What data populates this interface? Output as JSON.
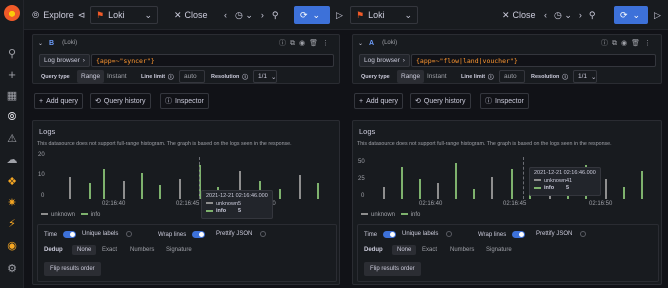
{
  "sidebar": {
    "icons": [
      "grafana-logo-icon",
      "search-icon",
      "plus-icon",
      "dashboards-icon",
      "explore-icon",
      "alerting-icon",
      "cloud-icon",
      "plugin-icon",
      "shield-icon",
      "plugin2-icon",
      "globe-icon",
      "gear-icon"
    ]
  },
  "topbar": {
    "title": "Explore",
    "left_datasource": "Loki",
    "right_datasource": "Loki",
    "close_label": "Close"
  },
  "left": {
    "query": {
      "letter": "B",
      "datasource": "(Loki)",
      "log_browser": "Log browser",
      "expr": "{app=~\"syncer\"}",
      "query_type_label": "Query type",
      "range": "Range",
      "instant": "Instant",
      "line_limit_label": "Line limit",
      "line_limit_value": "auto",
      "resolution_label": "Resolution",
      "resolution_value": "1/1"
    },
    "actions": {
      "add": "Add query",
      "history": "Query history",
      "inspector": "Inspector"
    },
    "logs": {
      "title": "Logs",
      "note": "This datasource does not support full-range histogram. The graph is based on the logs seen in the response.",
      "y_ticks": [
        "20",
        "10",
        "0"
      ],
      "x_ticks": [
        "02:16:40",
        "02:16:45",
        "02:16:50"
      ],
      "legend": [
        "unknown",
        "info"
      ],
      "tooltip": {
        "time": "2021-12-21 02:16:46.000",
        "rows": [
          {
            "name": "unknown",
            "value": "5"
          },
          {
            "name": "info",
            "value": "5"
          }
        ]
      },
      "controls": {
        "time": "Time",
        "unique": "Unique labels",
        "wrap": "Wrap lines",
        "prettify": "Prettify JSON",
        "dedup": "Dedup",
        "none": "None",
        "exact": "Exact",
        "numbers": "Numbers",
        "signature": "Signature",
        "flip": "Flip results order"
      }
    }
  },
  "right": {
    "query": {
      "letter": "A",
      "datasource": "(Loki)",
      "log_browser": "Log browser",
      "expr": "{app=~\"flow|land|voucher\"}",
      "query_type_label": "Query type",
      "range": "Range",
      "instant": "Instant",
      "line_limit_label": "Line limit",
      "line_limit_value": "auto",
      "resolution_label": "Resolution",
      "resolution_value": "1/1"
    },
    "actions": {
      "add": "Add query",
      "history": "Query history",
      "inspector": "Inspector"
    },
    "logs": {
      "title": "Logs",
      "note": "This datasource does not support full-range histogram. The graph is based on the logs seen in the response.",
      "y_ticks": [
        "50",
        "25",
        "0"
      ],
      "x_ticks": [
        "02:16:40",
        "02:16:45",
        "02:16:50"
      ],
      "legend": [
        "unknown",
        "info"
      ],
      "tooltip": {
        "time": "2021-12-21 02:16:46.000",
        "rows": [
          {
            "name": "unknown",
            "value": "41"
          },
          {
            "name": "info",
            "value": "5"
          }
        ]
      },
      "controls": {
        "time": "Time",
        "unique": "Unique labels",
        "wrap": "Wrap lines",
        "prettify": "Prettify JSON",
        "dedup": "Dedup",
        "none": "None",
        "exact": "Exact",
        "numbers": "Numbers",
        "signature": "Signature",
        "flip": "Flip results order"
      }
    }
  },
  "colors": {
    "unknown": "#8e8e8e",
    "info": "#7eb26d",
    "accent": "#3d71d9",
    "expr": "#ff9830"
  }
}
